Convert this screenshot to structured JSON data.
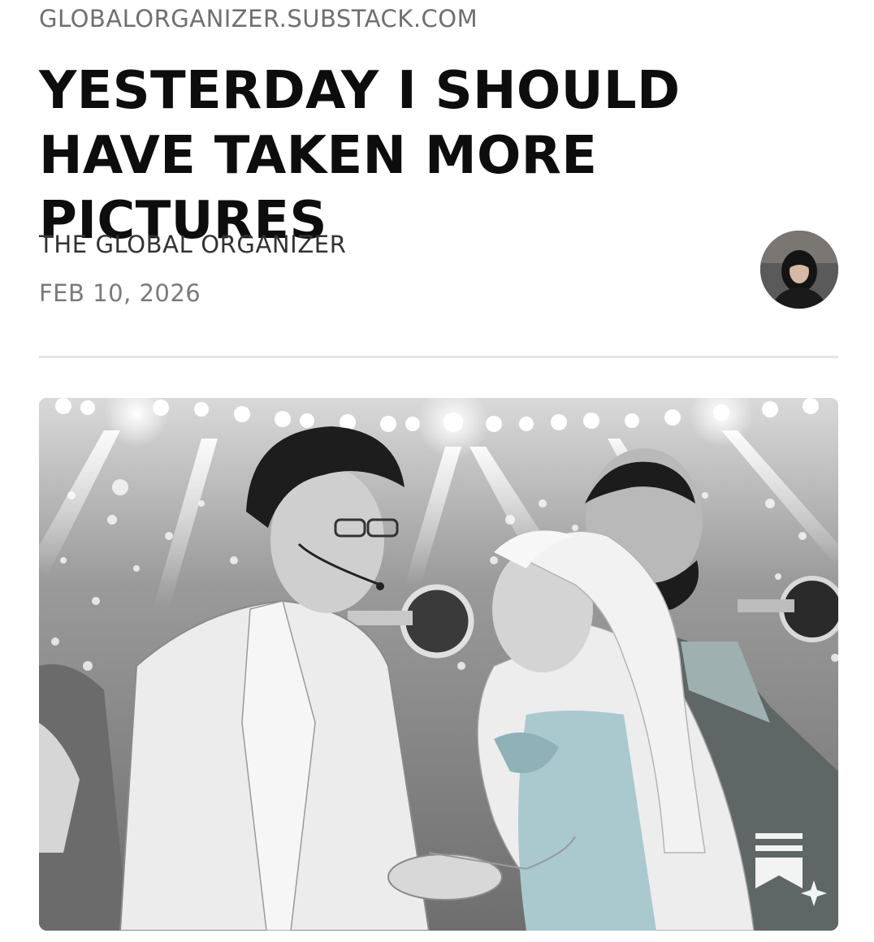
{
  "header": {
    "source": "GLOBALORGANIZER.SUBSTACK.COM"
  },
  "article": {
    "title": "YESTERDAY I SHOULD HAVE TAKEN MORE PICTURES",
    "author": "THE GLOBAL ORGANIZER",
    "date": "FEB 10, 2026",
    "avatar_icon": "author-avatar-photo",
    "hero_image_icon": "illustration-stage-couple-dancing"
  },
  "actions": {
    "save_icon": "bookmark-sparkle-icon"
  },
  "colors": {
    "title": "#0d0d0d",
    "meta": "#6f6f6f",
    "divider": "#e4e4e4",
    "dress": "#a9c9cf"
  }
}
